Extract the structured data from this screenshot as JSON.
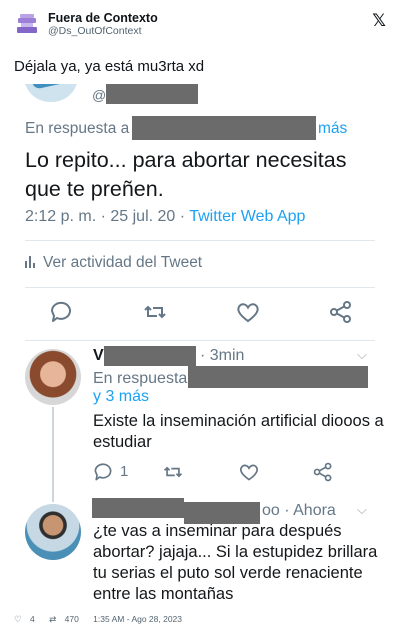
{
  "outer": {
    "author_name": "Fuera de Contexto",
    "author_handle": "@Ds_OutOfContext",
    "platform_icon": "x-logo",
    "caption": "Déjala ya, ya está mu3rta xd",
    "footer": {
      "likes": "4",
      "retweets": "470",
      "timestamp": "1:35 AM - Ago 28, 2023"
    }
  },
  "embedded": {
    "main_tweet": {
      "handle_prefix": "@",
      "reply_prefix": "En respuesta a",
      "reply_suffix": "más",
      "text": "Lo repito...  para abortar necesitas que te preñen.",
      "time": "2:12 p. m. · 25 jul. 20 · ",
      "app": "Twitter Web App",
      "activity_label": "Ver actividad del Tweet"
    },
    "reply1": {
      "name_initial": "V",
      "time": "· 3min",
      "reply_prefix": "En respuesta",
      "reply_more": "y 3 más",
      "text": "Existe la inseminación artificial diooos a estudiar",
      "reply_count": "1"
    },
    "reply2": {
      "time": "oo · Ahora",
      "text": "¿te vas a inseminar para después abortar? jajaja... Si la estupidez brillara tu serias el puto sol verde renaciente entre las montañas"
    }
  }
}
